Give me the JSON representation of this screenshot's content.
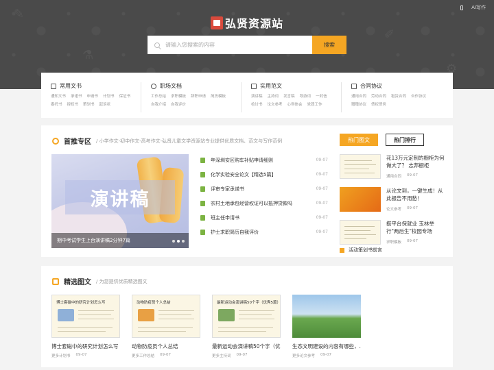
{
  "header": {
    "top_link": "AI写作",
    "logo_text": "弘贤资源站",
    "search_placeholder": "请输入您搜索的内容",
    "search_button": "搜索"
  },
  "categories": [
    {
      "name": "常用文书",
      "links": [
        "通知文书",
        "承诺书",
        "申请书",
        "计划书",
        "保证书",
        "委托书",
        "授权书",
        "策划书",
        "起诉状"
      ]
    },
    {
      "name": "职场文档",
      "links": [
        "工作总结",
        "求职模板",
        "辞职申请",
        "简历模板",
        "自我介绍",
        "自我评价"
      ]
    },
    {
      "name": "实用范文",
      "links": [
        "演讲稿",
        "主持词",
        "发言稿",
        "导游词",
        "一封信",
        "检讨书",
        "论文参考",
        "心得体会",
        "党团工作"
      ]
    },
    {
      "name": "合同协议",
      "links": [
        "通用合同",
        "劳动合同",
        "租赁合同",
        "合作协议",
        "赠赠协议",
        "债权债务"
      ]
    }
  ],
  "recommend": {
    "title": "首推专区",
    "subtitle": "/ 小学作文-初中作文-高考作文-弘贤儿童文学资源站专业提供优质文档、范文与写作范例",
    "banner_text": "演讲稿",
    "banner_caption": "期中考试学生上台演讲稿2分钟7篇",
    "items": [
      {
        "title": "年深圳安区购车补贴申请细则",
        "date": "09-07"
      },
      {
        "title": "化学实验安全论文【精选5篇】",
        "date": "09-07"
      },
      {
        "title": "评审专家承诺书",
        "date": "09-07"
      },
      {
        "title": "农村土地承包经营权证可以抵押贷款吗",
        "date": "09-07"
      },
      {
        "title": "班主任申请书",
        "date": "09-07"
      },
      {
        "title": "护士求职简历自我评价",
        "date": "09-07"
      }
    ],
    "tab_hot": "热门图文",
    "tab_rank": "热门排行",
    "hot": [
      {
        "title": "花13万元定制的橱柜为何做大了？ 志邦橱柜",
        "category": "通用合同",
        "date": "09-07"
      },
      {
        "title": "从论文到，一键生成！从此报告不用愁！",
        "category": "论文参考",
        "date": "09-07"
      },
      {
        "title": "搭平台保就业 玉林举行\"两后生\"校园专场",
        "category": "求职模板",
        "date": "09-07"
      }
    ],
    "hot_extra": "活动策划书前言"
  },
  "selected": {
    "title": "精选图文",
    "subtitle": "/ 为您提供优质精选图文",
    "cards": [
      {
        "thumb_title": "博士套磁中的研究计划怎么写",
        "title": "博士套磁中的研究计划怎么写",
        "category": "更多计划书",
        "date": "09-07"
      },
      {
        "thumb_title": "动物防疫员个人总结",
        "title": "动物防疫员个人总结",
        "category": "更多工作总结",
        "date": "09-07"
      },
      {
        "thumb_title": "最新运动会演讲稿50个字（优秀5篇）",
        "title": "最新运动会演讲稿50个字（优...",
        "category": "更多主持词",
        "date": "09-07"
      },
      {
        "thumb_title": "",
        "title": "生态文明建设的内容有哪些，...",
        "category": "更多论文参考",
        "date": "09-07"
      }
    ]
  }
}
